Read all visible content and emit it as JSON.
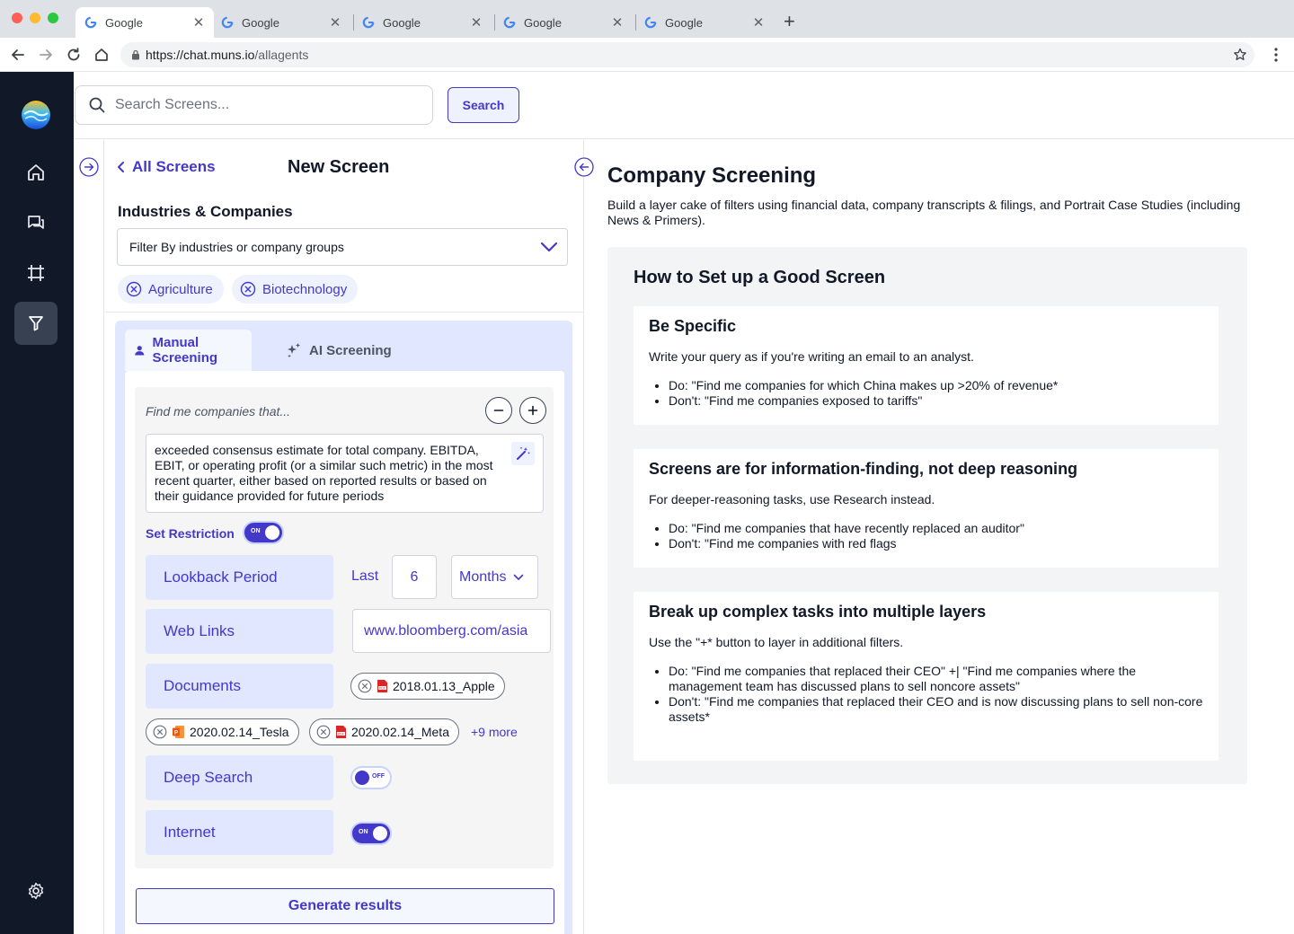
{
  "browser": {
    "tabs": [
      {
        "title": "Google"
      },
      {
        "title": "Google"
      },
      {
        "title": "Google"
      },
      {
        "title": "Google"
      },
      {
        "title": "Google"
      }
    ],
    "url_host": "https://chat.muns.io",
    "url_path": "/allagents"
  },
  "sidebar": {
    "items": [
      {
        "icon": "home-icon"
      },
      {
        "icon": "chat-icon"
      },
      {
        "icon": "frame-icon"
      },
      {
        "icon": "filter-icon",
        "active": true
      }
    ],
    "settings_icon": "gear-icon"
  },
  "search": {
    "placeholder": "Search Screens...",
    "button_label": "Search"
  },
  "form": {
    "back_label": "All Screens",
    "title": "New Screen",
    "industries_label": "Industries & Companies",
    "industries_placeholder": "Filter By industries or company groups",
    "chips": [
      "Agriculture",
      "Biotechnology"
    ],
    "tabs": {
      "manual": "Manual Screening",
      "ai": "AI Screening"
    },
    "query_prompt": "Find me companies that...",
    "query_text": "exceeded consensus estimate for total company. EBITDA, EBIT, or operating profit (or a similar such metric) in the most recent quarter, either based on reported results or based on their guidance provided for future periods",
    "set_restriction_label": "Set Restriction",
    "set_restriction_toggle": "ON",
    "lookback": {
      "label": "Lookback Period",
      "last_label": "Last",
      "value": "6",
      "unit": "Months"
    },
    "web_links": {
      "label": "Web Links",
      "value": "www.bloomberg.com/asia"
    },
    "documents": {
      "label": "Documents",
      "files": [
        {
          "name": "2018.01.13_Apple",
          "type": "pdf"
        },
        {
          "name": "2020.02.14_Tesla",
          "type": "ppt"
        },
        {
          "name": "2020.02.14_Meta",
          "type": "pdf"
        }
      ],
      "more_label": "+9 more"
    },
    "deep_search": {
      "label": "Deep Search",
      "toggle": "OFF"
    },
    "internet": {
      "label": "Internet",
      "toggle": "ON"
    },
    "generate_label": "Generate results"
  },
  "guide": {
    "title": "Company Screening",
    "subtitle": "Build a layer cake of filters using financial data, company transcripts & filings, and Portrait Case Studies (including News & Primers).",
    "box_title": "How to Set up a Good Screen",
    "tips": [
      {
        "title": "Be Specific",
        "desc": "Write your query as if you're writing an email to an analyst.",
        "bullets": [
          "Do: \"Find me companies for which China makes up >20% of revenue*",
          "Don't: \"Find me companies exposed to tariffs\""
        ]
      },
      {
        "title": "Screens are for information-finding, not deep reasoning",
        "desc": "For deeper-reasoning tasks, use Research instead.",
        "bullets": [
          "Do: \"Find me companies that have recently replaced an auditor\"",
          "Don't: \"Find me companies with red flags"
        ]
      },
      {
        "title": "Break up complex tasks into multiple layers",
        "desc": "Use the \"+* button to layer in additional filters.",
        "bullets": [
          "Do: \"Find me companies that replaced their CEO\" +| \"Find me companies where the management team has discussed plans to sell noncore assets\"",
          "Don't: \"Find me companies that replaced their CEO and is now discussing plans to sell non-core assets*"
        ]
      }
    ]
  },
  "colors": {
    "accent": "#4338ca",
    "accent_light": "#e0e7ff",
    "sidebar_bg": "#111827"
  }
}
